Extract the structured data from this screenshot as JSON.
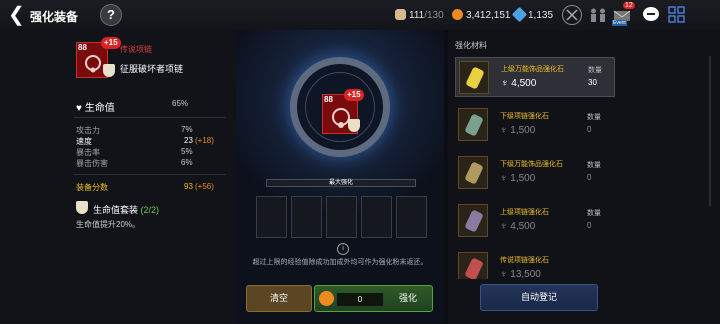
{
  "header": {
    "back_glyph": "❮",
    "title": "强化装备",
    "help_glyph": "?",
    "stamina_value": "111",
    "stamina_max": "/130",
    "gold": "3,412,151",
    "gems": "1,135",
    "mail_badge": "12",
    "event_label": "Event"
  },
  "item": {
    "level": "88",
    "enhance": "+15",
    "rarity": "传说项链",
    "name": "征服破坏者项链",
    "main_stat_label": "生命值",
    "main_stat_value": "65%",
    "stats": [
      {
        "label": "攻击力",
        "value": "7%",
        "bonus": ""
      },
      {
        "label": "速度",
        "value": "23",
        "bonus": "(+18)"
      },
      {
        "label": "暴击率",
        "value": "5%",
        "bonus": ""
      },
      {
        "label": "暴击伤害",
        "value": "6%",
        "bonus": ""
      }
    ],
    "score_label": "装备分数",
    "score_value": "93",
    "score_bonus": "(+56)",
    "set_name": "生命值套装",
    "set_count": "(2/2)",
    "set_desc": "生命值提升20%。"
  },
  "center": {
    "max_label": "最大强化",
    "note": "超过上限的经验值除成功加成外均可作为强化粉末返还。",
    "clear_label": "清空",
    "cost": "0",
    "enhance_label": "强化",
    "info_glyph": "i"
  },
  "materials": {
    "header": "强化材料",
    "qty_label": "数量",
    "items": [
      {
        "name": "上级万能饰品强化石",
        "price": "4,500",
        "qty": "30",
        "stone_color": "#e8d040",
        "selected": true
      },
      {
        "name": "下级项链强化石",
        "price": "1,500",
        "qty": "0",
        "stone_color": "#7aa090",
        "selected": false
      },
      {
        "name": "下级万能饰品强化石",
        "price": "1,500",
        "qty": "0",
        "stone_color": "#b09a60",
        "selected": false
      },
      {
        "name": "上级项链强化石",
        "price": "4,500",
        "qty": "0",
        "stone_color": "#8a7aa0",
        "selected": false
      },
      {
        "name": "传说项链强化石",
        "price": "13,500",
        "qty": "",
        "stone_color": "#c05050",
        "selected": false
      }
    ],
    "auto_label": "自动登记"
  }
}
